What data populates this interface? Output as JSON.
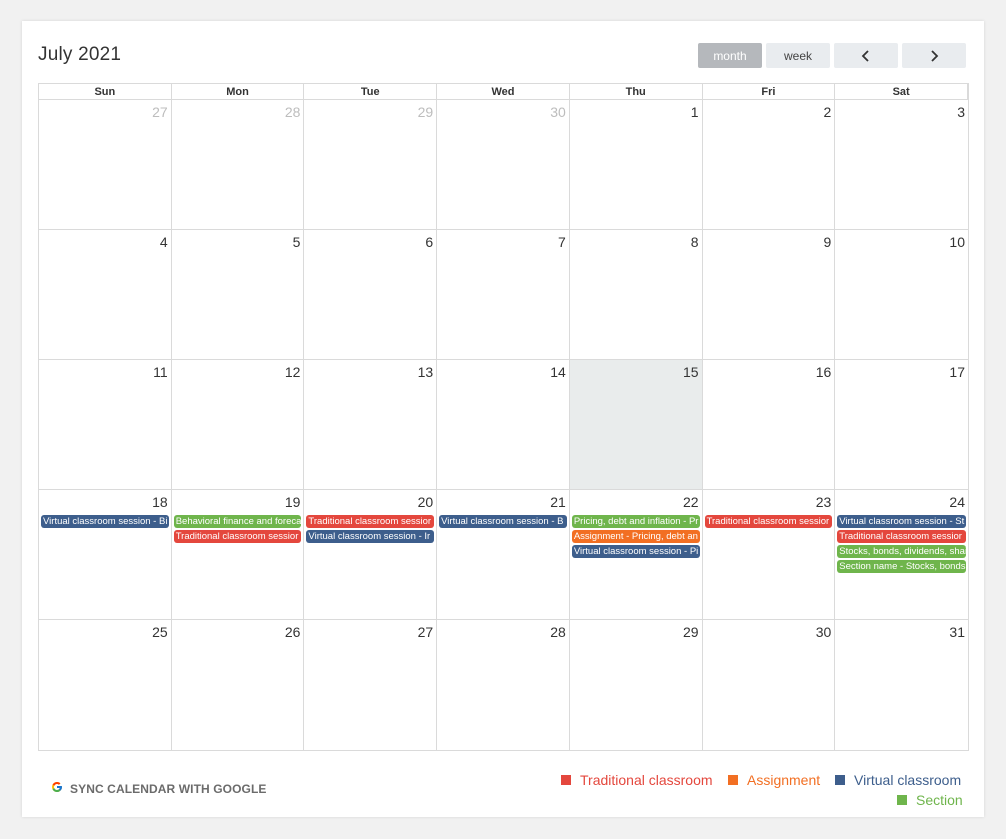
{
  "calendar": {
    "title": "July 2021",
    "view_buttons": {
      "month": "month",
      "week": "week"
    },
    "days_of_week": [
      "Sun",
      "Mon",
      "Tue",
      "Wed",
      "Thu",
      "Fri",
      "Sat"
    ],
    "weeks": [
      [
        {
          "n": "27",
          "other": true
        },
        {
          "n": "28",
          "other": true
        },
        {
          "n": "29",
          "other": true
        },
        {
          "n": "30",
          "other": true
        },
        {
          "n": "1"
        },
        {
          "n": "2"
        },
        {
          "n": "3"
        }
      ],
      [
        {
          "n": "4"
        },
        {
          "n": "5"
        },
        {
          "n": "6"
        },
        {
          "n": "7"
        },
        {
          "n": "8"
        },
        {
          "n": "9"
        },
        {
          "n": "10"
        }
      ],
      [
        {
          "n": "11"
        },
        {
          "n": "12"
        },
        {
          "n": "13"
        },
        {
          "n": "14"
        },
        {
          "n": "15",
          "today": true
        },
        {
          "n": "16"
        },
        {
          "n": "17"
        }
      ],
      [
        {
          "n": "18",
          "events": [
            {
              "title": "Virtual classroom session - Bi",
              "type": "virtual"
            }
          ]
        },
        {
          "n": "19",
          "events": [
            {
              "title": "Behavioral finance and foreca",
              "type": "section"
            },
            {
              "title": "Traditional classroom sessior",
              "type": "traditional"
            }
          ]
        },
        {
          "n": "20",
          "events": [
            {
              "title": "Traditional classroom sessior",
              "type": "traditional"
            },
            {
              "title": "Virtual classroom session - Ir",
              "type": "virtual"
            }
          ]
        },
        {
          "n": "21",
          "events": [
            {
              "title": "Virtual classroom session - B",
              "type": "virtual"
            }
          ]
        },
        {
          "n": "22",
          "events": [
            {
              "title": "Pricing, debt and inflation - Pr",
              "type": "section"
            },
            {
              "title": "Assignment - Pricing, debt an",
              "type": "assignment"
            },
            {
              "title": "Virtual classroom session - Pi",
              "type": "virtual"
            }
          ]
        },
        {
          "n": "23",
          "events": [
            {
              "title": "Traditional classroom sessior",
              "type": "traditional"
            }
          ]
        },
        {
          "n": "24",
          "events": [
            {
              "title": "Virtual classroom session - St",
              "type": "virtual"
            },
            {
              "title": "Traditional classroom sessior",
              "type": "traditional"
            },
            {
              "title": "Stocks, bonds, dividends, shai",
              "type": "section"
            },
            {
              "title": "Section name - Stocks, bonds",
              "type": "section"
            }
          ]
        }
      ],
      [
        {
          "n": "25"
        },
        {
          "n": "26"
        },
        {
          "n": "27"
        },
        {
          "n": "28"
        },
        {
          "n": "29"
        },
        {
          "n": "30"
        },
        {
          "n": "31"
        }
      ]
    ]
  },
  "sync": {
    "label": "SYNC CALENDAR WITH GOOGLE",
    "icon": "google-g-icon"
  },
  "legend": {
    "traditional": "Traditional classroom",
    "assignment": "Assignment",
    "virtual": "Virtual classroom",
    "section": "Section"
  },
  "colors": {
    "traditional": "#e4473d",
    "assignment": "#f26f23",
    "virtual": "#3d5e8c",
    "section": "#6fb54c",
    "today_bg": "#e9ecec",
    "active_button": "#b5b8bc"
  },
  "icons": {
    "prev": "chevron-left-icon",
    "next": "chevron-right-icon"
  }
}
